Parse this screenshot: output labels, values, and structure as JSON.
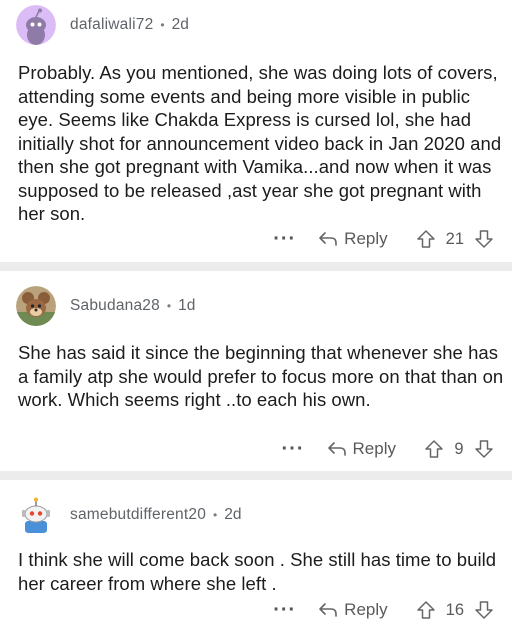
{
  "comments": [
    {
      "username": "dafaliwali72",
      "separator": "•",
      "age": "2d",
      "avatar_icon": "snoo-purple-avatar-icon",
      "text": "Probably. As you mentioned, she was doing lots of covers, attending some events and being more visible in public eye. Seems like Chakda Express is cursed lol, she had initially shot for announcement video back in Jan 2020 and then she got pregnant with Vamika...and now when it was supposed to be released ,ast year she got pregnant with her son.",
      "more_label": "···",
      "reply_label": "Reply",
      "votes": "21"
    },
    {
      "username": "Sabudana28",
      "separator": "•",
      "age": "1d",
      "avatar_icon": "cartoon-mouse-avatar-icon",
      "text": "She has said it since the beginning that whenever she has a family atp she would prefer to focus more on  that than on work. Which seems right ..to each his own.",
      "more_label": "···",
      "reply_label": "Reply",
      "votes": "9"
    },
    {
      "username": "samebutdifferent20",
      "separator": "•",
      "age": "2d",
      "avatar_icon": "snoo-robot-avatar-icon",
      "text": "I think she will come back soon . She still has time to build her career from where she left .",
      "more_label": "···",
      "reply_label": "Reply",
      "votes": "16"
    }
  ],
  "colors": {
    "divider": "#ececec",
    "meta_text": "#5f6368",
    "body_text": "#1c1c1c",
    "avatar_purple": "#d9b8f5"
  }
}
